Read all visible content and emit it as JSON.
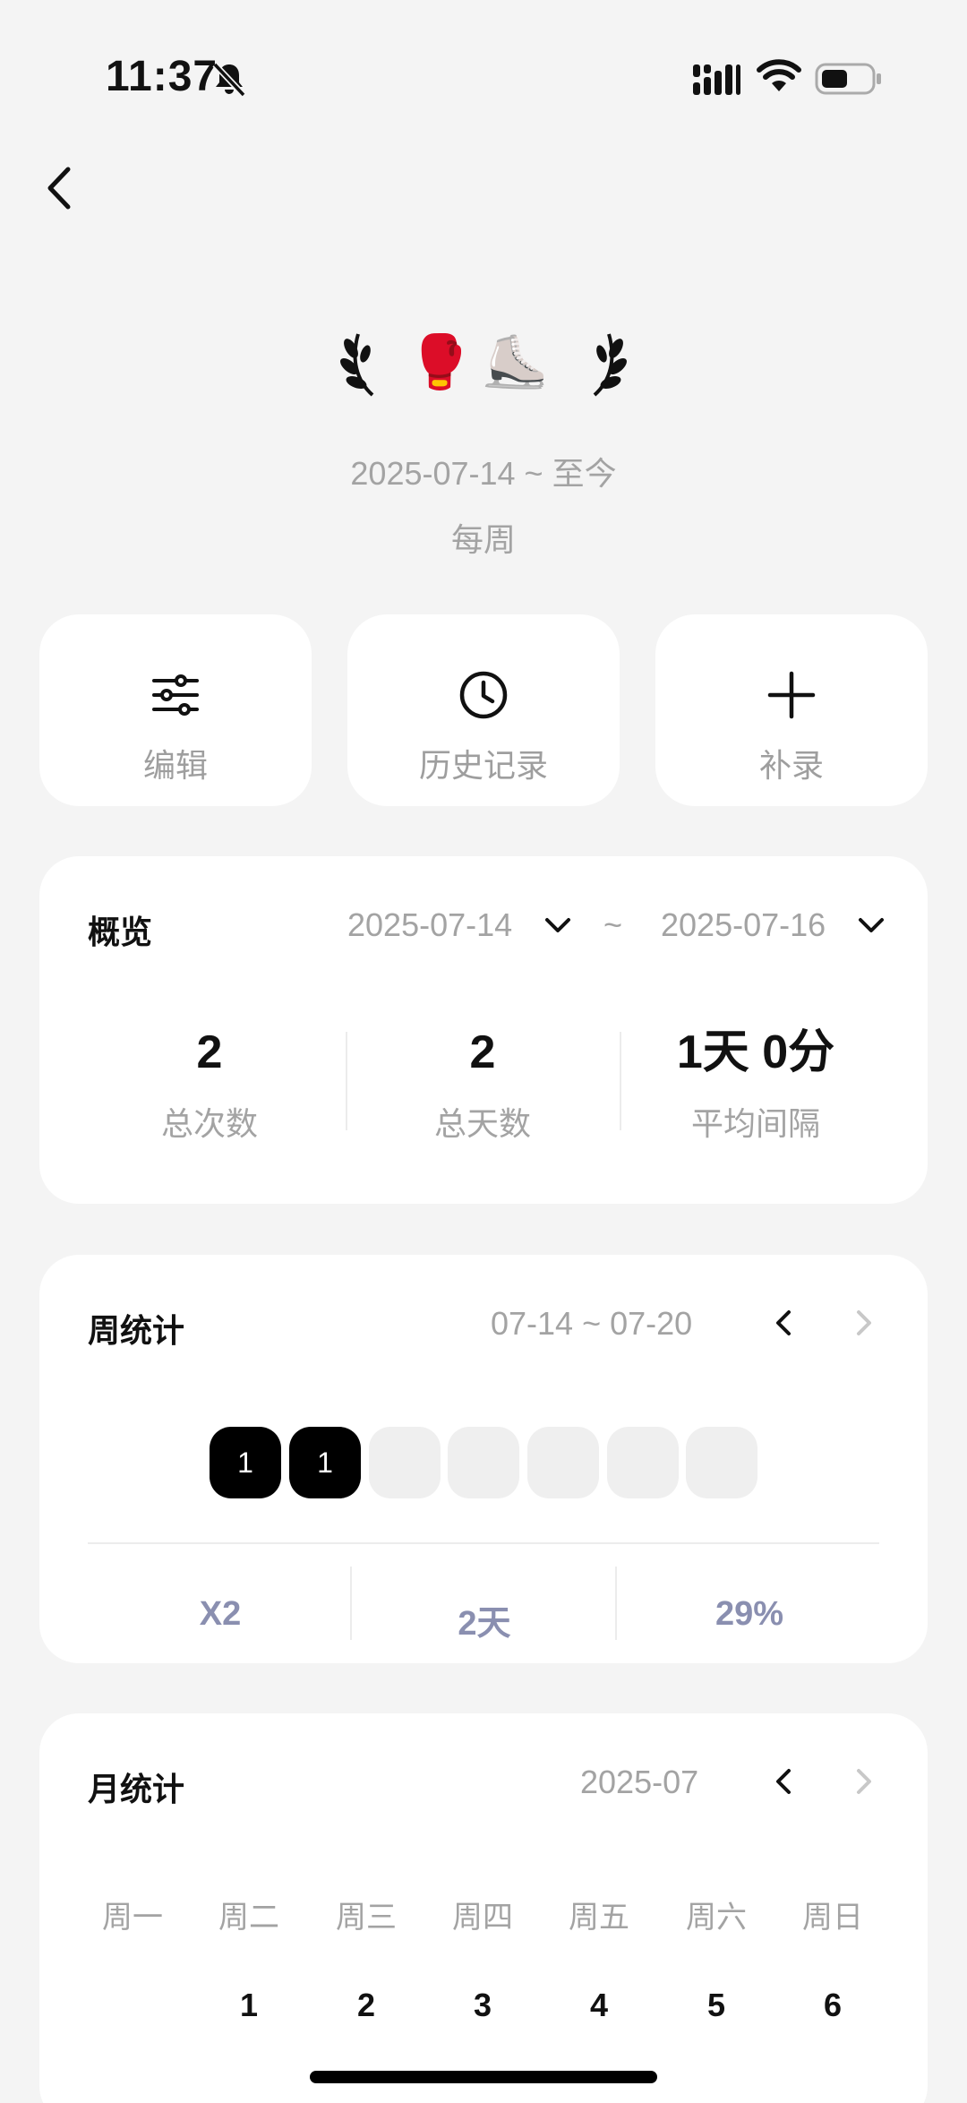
{
  "status_bar": {
    "time": "11:37"
  },
  "habit": {
    "emoji": "🥊⛸️",
    "date_range": "2025-07-14 ~ 至今",
    "frequency": "每周"
  },
  "actions": [
    {
      "label": "编辑",
      "icon": "sliders-icon"
    },
    {
      "label": "历史记录",
      "icon": "clock-icon"
    },
    {
      "label": "补录",
      "icon": "plus-icon"
    }
  ],
  "overview": {
    "title": "概览",
    "start_date": "2025-07-14",
    "separator": "~",
    "end_date": "2025-07-16",
    "stats": [
      {
        "value": "2",
        "label": "总次数"
      },
      {
        "value": "2",
        "label": "总天数"
      },
      {
        "value": "1天 0分",
        "label": "平均间隔"
      }
    ]
  },
  "weekly": {
    "title": "周统计",
    "range": "07-14 ~ 07-20",
    "days": [
      "1",
      "1",
      "",
      "",
      "",
      "",
      ""
    ],
    "stats": [
      "X2",
      "2天",
      "29%"
    ]
  },
  "monthly": {
    "title": "月统计",
    "month": "2025-07",
    "weekdays": [
      "周一",
      "周二",
      "周三",
      "周四",
      "周五",
      "周六",
      "周日"
    ],
    "first_row": [
      "",
      "1",
      "2",
      "3",
      "4",
      "5",
      "6"
    ]
  },
  "colors": {
    "background": "#f4f4f4",
    "card": "#ffffff",
    "muted_text": "#a3a3a3",
    "week_stat": "#8a8fb0",
    "active_day": "#000000",
    "inactive_day": "#efefef"
  }
}
